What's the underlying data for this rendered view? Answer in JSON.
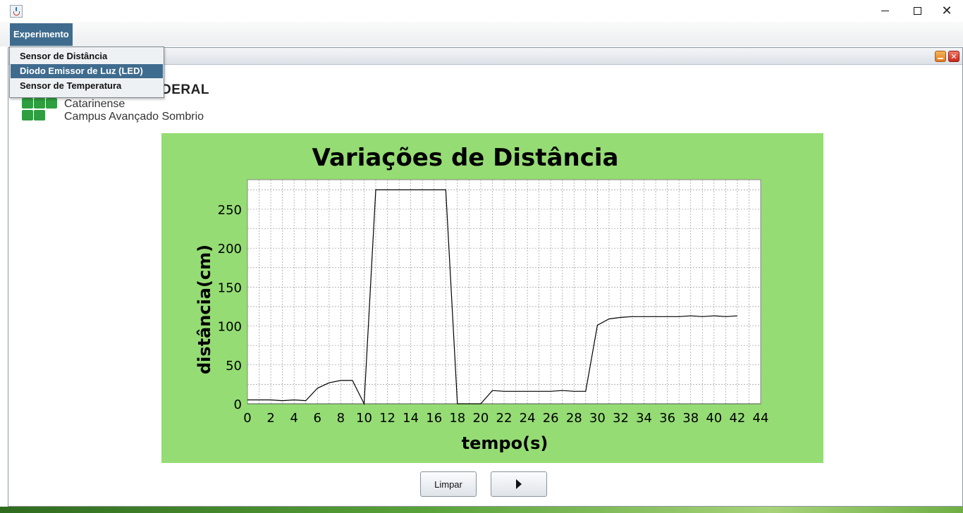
{
  "menubar": {
    "experimento_label": "Experimento"
  },
  "dropdown": {
    "items": [
      {
        "label": "Sensor de Distância",
        "selected": false
      },
      {
        "label": "Diodo Emissor de Luz (LED)",
        "selected": true
      },
      {
        "label": "Sensor de Temperatura",
        "selected": false
      }
    ]
  },
  "logo": {
    "partial_title": "DERAL",
    "line1": "Catarinense",
    "line2": "Campus Avançado Sombrio",
    "color": "#2f9e41"
  },
  "buttons": {
    "limpar": "Limpar",
    "play_icon": "play-icon"
  },
  "colors": {
    "chart_bg": "#95dc74",
    "menu_selected": "#3f6c8e"
  },
  "chart_data": {
    "type": "line",
    "title": "Variações de Distância",
    "xlabel": "tempo(s)",
    "ylabel": "distância(cm)",
    "xlim": [
      0,
      44
    ],
    "ylim": [
      0,
      288
    ],
    "xticks": [
      0,
      2,
      4,
      6,
      8,
      10,
      12,
      14,
      16,
      18,
      20,
      22,
      24,
      26,
      28,
      30,
      32,
      34,
      36,
      38,
      40,
      42,
      44
    ],
    "yticks": [
      0,
      50,
      100,
      150,
      200,
      250
    ],
    "grid": true,
    "series": [
      {
        "x": [
          0,
          1,
          2,
          3,
          4,
          5,
          6,
          7,
          8,
          9,
          10,
          11,
          12,
          13,
          14,
          15,
          16,
          17,
          18,
          19,
          20,
          21,
          22,
          23,
          24,
          25,
          26,
          27,
          28,
          29,
          30,
          31,
          32,
          33,
          34,
          35,
          36,
          37,
          38,
          39,
          40,
          41,
          42
        ],
        "y": [
          5,
          5,
          5,
          4,
          5,
          4,
          20,
          27,
          30,
          30,
          0,
          275,
          275,
          275,
          275,
          275,
          275,
          275,
          0,
          0,
          0,
          17,
          16,
          16,
          16,
          16,
          16,
          17,
          16,
          16,
          101,
          109,
          111,
          112,
          112,
          112,
          112,
          112,
          113,
          112,
          113,
          112,
          113
        ]
      }
    ]
  }
}
